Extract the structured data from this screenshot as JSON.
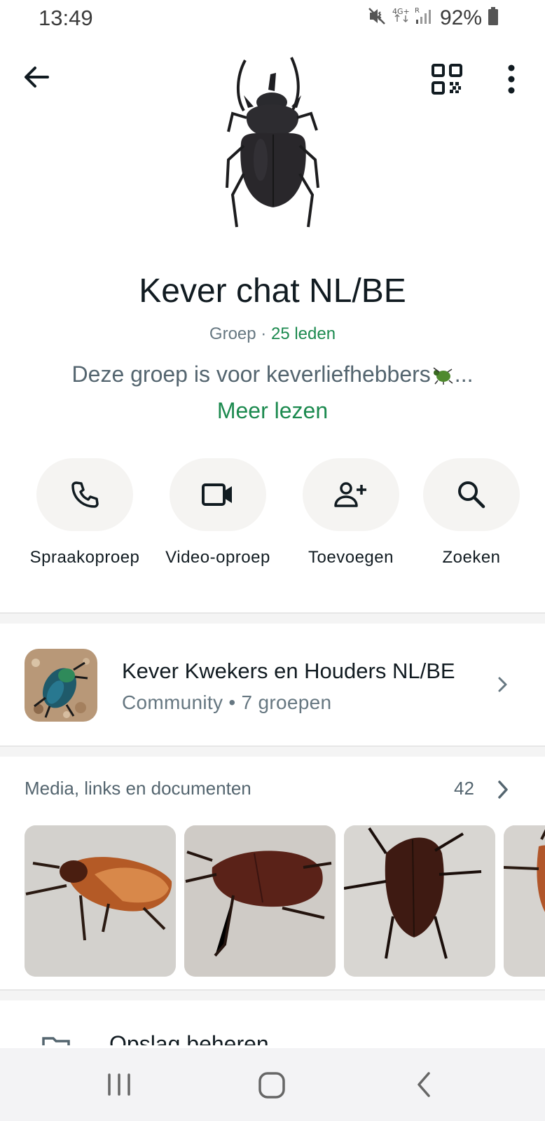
{
  "status_bar": {
    "time": "13:49",
    "network": "4G+",
    "roaming": "R",
    "battery": "92%",
    "icons": [
      "mute-vibrate-icon",
      "signal-icon",
      "battery-icon"
    ]
  },
  "header": {
    "icons": [
      "arrow-back-icon",
      "qr-code-icon",
      "more-vertical-icon"
    ]
  },
  "group": {
    "name": "Kever chat NL/BE",
    "type": "Groep",
    "separator": "·",
    "members": "25 leden",
    "description": "Deze groep is voor keverliefhebbers",
    "description_ellipsis": "...",
    "read_more": "Meer lezen"
  },
  "actions": [
    {
      "label": "Spraakoproep",
      "icon": "phone-icon"
    },
    {
      "label": "Video-oproep",
      "icon": "video-camera-icon"
    },
    {
      "label": "Toevoegen",
      "icon": "add-person-icon"
    },
    {
      "label": "Zoeken",
      "icon": "search-icon"
    }
  ],
  "community": {
    "title": "Kever Kwekers en Houders NL/BE",
    "subtitle": "Community • 7 groepen"
  },
  "media": {
    "title": "Media, links en documenten",
    "count": "42"
  },
  "storage": {
    "label": "Opslag beheren"
  },
  "colors": {
    "accent_green": "#1c8a4f",
    "pill_bg": "#f5f4f2",
    "secondary_text": "#667781"
  }
}
